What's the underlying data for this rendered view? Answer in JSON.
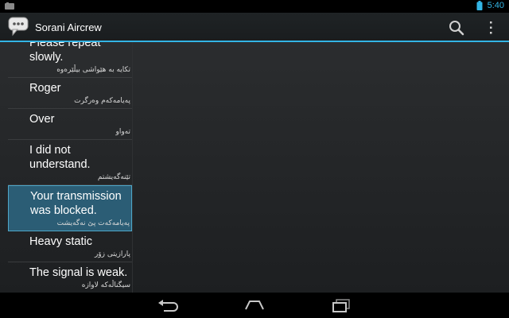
{
  "status_bar": {
    "time": "5:40",
    "icons": [
      "notification-icon",
      "battery-icon"
    ],
    "accent_color": "#33b5e5"
  },
  "action_bar": {
    "title": "Sorani Aircrew",
    "app_icon": "speech-bubbles-icon",
    "actions": [
      "search-icon",
      "overflow-menu-icon"
    ]
  },
  "phrases": [
    {
      "english": "Please repeat\nslowly.",
      "sorani": "تکایە بە هێواشی بیڵێرەوە"
    },
    {
      "english": "Roger",
      "sorani": "پەیامەکەم وەرگرت"
    },
    {
      "english": "Over",
      "sorani": "تەواو"
    },
    {
      "english": "I did not\nunderstand.",
      "sorani": "تێنەگەیشتم"
    },
    {
      "english": "Your transmission\nwas blocked.",
      "sorani": "پەیامەکەت پێ نەگەیشت",
      "selected": true
    },
    {
      "english": "Heavy static",
      "sorani": "پارازیتی زۆر"
    },
    {
      "english": "The signal is weak.",
      "sorani": "سیگناڵەکە لاوازە"
    }
  ],
  "nav_bar": {
    "buttons": [
      "back-icon",
      "home-icon",
      "recent-apps-icon"
    ]
  }
}
